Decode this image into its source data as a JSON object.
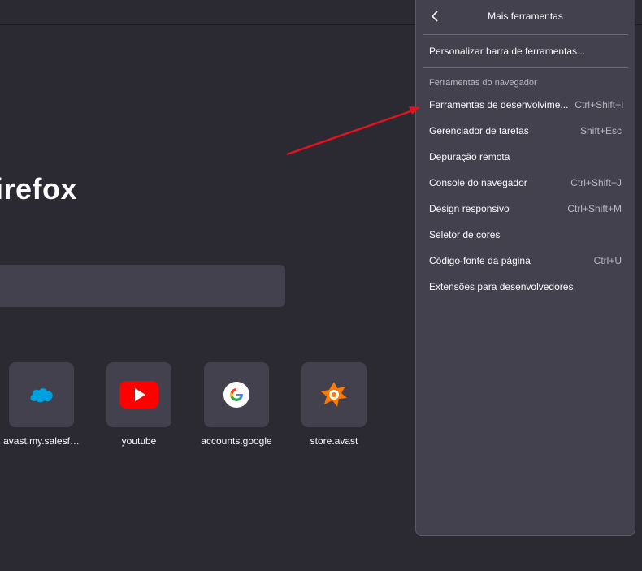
{
  "brand": {
    "text": "irefox"
  },
  "tiles": [
    {
      "label": "avast.my.salesf…",
      "icon": "salesforce-cloud-icon"
    },
    {
      "label": "youtube",
      "icon": "youtube-icon"
    },
    {
      "label": "accounts.google",
      "icon": "google-g-icon"
    },
    {
      "label": "store.avast",
      "icon": "avast-icon"
    }
  ],
  "panel": {
    "title": "Mais ferramentas",
    "customize": "Personalizar barra de ferramentas...",
    "section_title": "Ferramentas do navegador",
    "items": [
      {
        "label": "Ferramentas de desenvolvime...",
        "shortcut": "Ctrl+Shift+I"
      },
      {
        "label": "Gerenciador de tarefas",
        "shortcut": "Shift+Esc"
      },
      {
        "label": "Depuração remota",
        "shortcut": ""
      },
      {
        "label": "Console do navegador",
        "shortcut": "Ctrl+Shift+J"
      },
      {
        "label": "Design responsivo",
        "shortcut": "Ctrl+Shift+M"
      },
      {
        "label": "Seletor de cores",
        "shortcut": ""
      },
      {
        "label": "Código-fonte da página",
        "shortcut": "Ctrl+U"
      },
      {
        "label": "Extensões para desenvolvedores",
        "shortcut": ""
      }
    ]
  },
  "colors": {
    "background": "#2b2a33",
    "panel": "#42414d",
    "annotation_arrow": "#e0141e",
    "youtube_red": "#ff0000",
    "salesforce_blue": "#00a1e0",
    "avast_orange": "#ff7800"
  }
}
